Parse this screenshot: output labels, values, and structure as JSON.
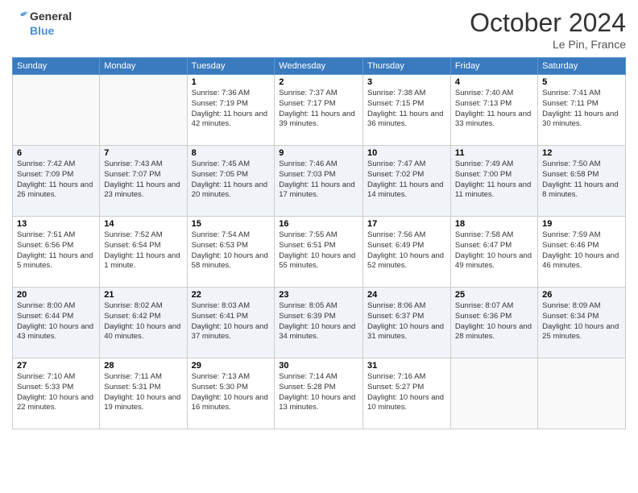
{
  "logo": {
    "line1": "General",
    "line2": "Blue"
  },
  "title": "October 2024",
  "location": "Le Pin, France",
  "days_header": [
    "Sunday",
    "Monday",
    "Tuesday",
    "Wednesday",
    "Thursday",
    "Friday",
    "Saturday"
  ],
  "weeks": [
    [
      {
        "day": "",
        "info": ""
      },
      {
        "day": "",
        "info": ""
      },
      {
        "day": "1",
        "sunrise": "7:36 AM",
        "sunset": "7:19 PM",
        "daylight": "11 hours and 42 minutes."
      },
      {
        "day": "2",
        "sunrise": "7:37 AM",
        "sunset": "7:17 PM",
        "daylight": "11 hours and 39 minutes."
      },
      {
        "day": "3",
        "sunrise": "7:38 AM",
        "sunset": "7:15 PM",
        "daylight": "11 hours and 36 minutes."
      },
      {
        "day": "4",
        "sunrise": "7:40 AM",
        "sunset": "7:13 PM",
        "daylight": "11 hours and 33 minutes."
      },
      {
        "day": "5",
        "sunrise": "7:41 AM",
        "sunset": "7:11 PM",
        "daylight": "11 hours and 30 minutes."
      }
    ],
    [
      {
        "day": "6",
        "sunrise": "7:42 AM",
        "sunset": "7:09 PM",
        "daylight": "11 hours and 26 minutes."
      },
      {
        "day": "7",
        "sunrise": "7:43 AM",
        "sunset": "7:07 PM",
        "daylight": "11 hours and 23 minutes."
      },
      {
        "day": "8",
        "sunrise": "7:45 AM",
        "sunset": "7:05 PM",
        "daylight": "11 hours and 20 minutes."
      },
      {
        "day": "9",
        "sunrise": "7:46 AM",
        "sunset": "7:03 PM",
        "daylight": "11 hours and 17 minutes."
      },
      {
        "day": "10",
        "sunrise": "7:47 AM",
        "sunset": "7:02 PM",
        "daylight": "11 hours and 14 minutes."
      },
      {
        "day": "11",
        "sunrise": "7:49 AM",
        "sunset": "7:00 PM",
        "daylight": "11 hours and 11 minutes."
      },
      {
        "day": "12",
        "sunrise": "7:50 AM",
        "sunset": "6:58 PM",
        "daylight": "11 hours and 8 minutes."
      }
    ],
    [
      {
        "day": "13",
        "sunrise": "7:51 AM",
        "sunset": "6:56 PM",
        "daylight": "11 hours and 5 minutes."
      },
      {
        "day": "14",
        "sunrise": "7:52 AM",
        "sunset": "6:54 PM",
        "daylight": "11 hours and 1 minute."
      },
      {
        "day": "15",
        "sunrise": "7:54 AM",
        "sunset": "6:53 PM",
        "daylight": "10 hours and 58 minutes."
      },
      {
        "day": "16",
        "sunrise": "7:55 AM",
        "sunset": "6:51 PM",
        "daylight": "10 hours and 55 minutes."
      },
      {
        "day": "17",
        "sunrise": "7:56 AM",
        "sunset": "6:49 PM",
        "daylight": "10 hours and 52 minutes."
      },
      {
        "day": "18",
        "sunrise": "7:58 AM",
        "sunset": "6:47 PM",
        "daylight": "10 hours and 49 minutes."
      },
      {
        "day": "19",
        "sunrise": "7:59 AM",
        "sunset": "6:46 PM",
        "daylight": "10 hours and 46 minutes."
      }
    ],
    [
      {
        "day": "20",
        "sunrise": "8:00 AM",
        "sunset": "6:44 PM",
        "daylight": "10 hours and 43 minutes."
      },
      {
        "day": "21",
        "sunrise": "8:02 AM",
        "sunset": "6:42 PM",
        "daylight": "10 hours and 40 minutes."
      },
      {
        "day": "22",
        "sunrise": "8:03 AM",
        "sunset": "6:41 PM",
        "daylight": "10 hours and 37 minutes."
      },
      {
        "day": "23",
        "sunrise": "8:05 AM",
        "sunset": "6:39 PM",
        "daylight": "10 hours and 34 minutes."
      },
      {
        "day": "24",
        "sunrise": "8:06 AM",
        "sunset": "6:37 PM",
        "daylight": "10 hours and 31 minutes."
      },
      {
        "day": "25",
        "sunrise": "8:07 AM",
        "sunset": "6:36 PM",
        "daylight": "10 hours and 28 minutes."
      },
      {
        "day": "26",
        "sunrise": "8:09 AM",
        "sunset": "6:34 PM",
        "daylight": "10 hours and 25 minutes."
      }
    ],
    [
      {
        "day": "27",
        "sunrise": "7:10 AM",
        "sunset": "5:33 PM",
        "daylight": "10 hours and 22 minutes."
      },
      {
        "day": "28",
        "sunrise": "7:11 AM",
        "sunset": "5:31 PM",
        "daylight": "10 hours and 19 minutes."
      },
      {
        "day": "29",
        "sunrise": "7:13 AM",
        "sunset": "5:30 PM",
        "daylight": "10 hours and 16 minutes."
      },
      {
        "day": "30",
        "sunrise": "7:14 AM",
        "sunset": "5:28 PM",
        "daylight": "10 hours and 13 minutes."
      },
      {
        "day": "31",
        "sunrise": "7:16 AM",
        "sunset": "5:27 PM",
        "daylight": "10 hours and 10 minutes."
      },
      {
        "day": "",
        "info": ""
      },
      {
        "day": "",
        "info": ""
      }
    ]
  ],
  "labels": {
    "sunrise": "Sunrise:",
    "sunset": "Sunset:",
    "daylight": "Daylight:"
  }
}
